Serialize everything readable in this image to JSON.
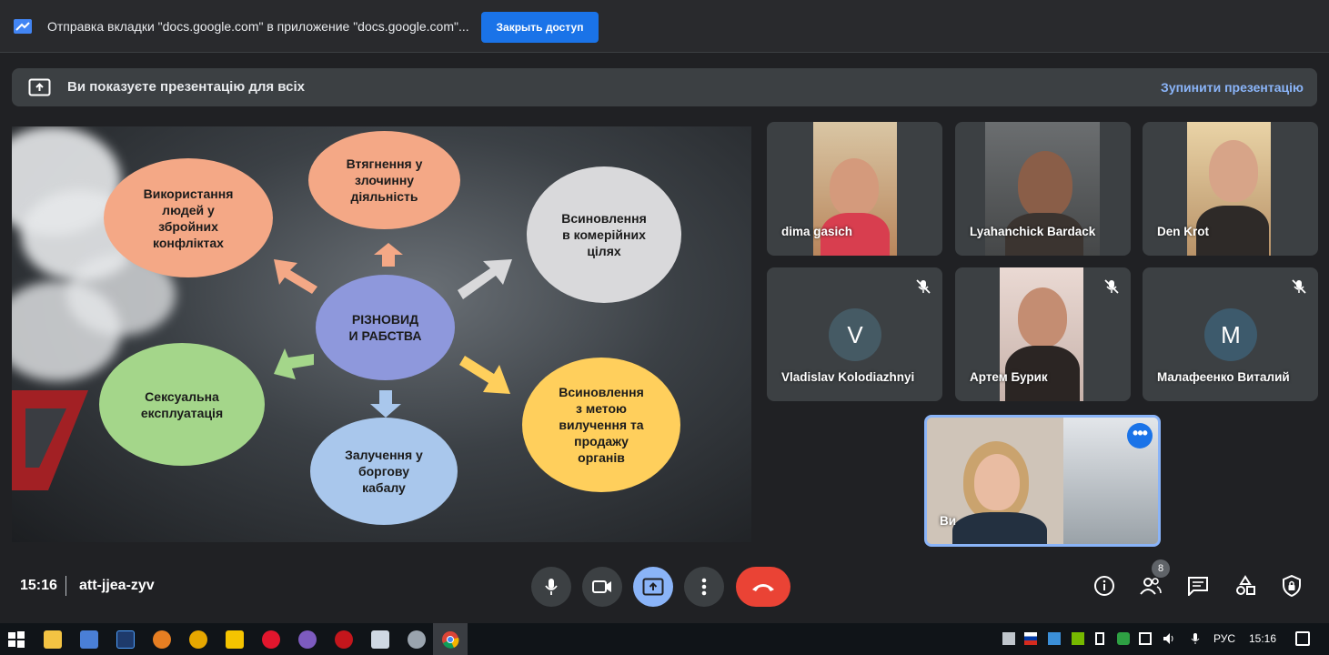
{
  "share_bar": {
    "text": "Отправка вкладки \"docs.google.com\" в приложение \"docs.google.com\"...",
    "stop_button": "Закрыть доступ"
  },
  "present_banner": {
    "text": "Ви показуєте презентацію для всіх",
    "stop_link": "Зупинити презентацію"
  },
  "slide": {
    "center": "РІЗНОВИД\nИ РАБСТВА",
    "bubbles": [
      "Використання\nлюдей у\nзбройних\nконфліктах",
      "Втягнення у\nзлочинну\nдіяльність",
      "Всиновлення\nв комерійних\nцілях",
      "Сексуальна\nексплуатація",
      "Залучення у\nборгову\nкабалу",
      "Всиновлення\nз метою\nвилучення та\nпродажу\nорганів"
    ]
  },
  "participants": [
    {
      "name": "dima gasich",
      "muted": false
    },
    {
      "name": "Lyahanchick Bardack",
      "muted": false
    },
    {
      "name": "Den Krot",
      "muted": false
    },
    {
      "name": "Vladislav Kolodiazhnyi",
      "initial": "V",
      "muted": true
    },
    {
      "name": "Артем Бурик",
      "muted": true
    },
    {
      "name": "Малафеенко Виталий",
      "initial": "M",
      "muted": true
    }
  ],
  "self_tile": {
    "name": "Ви"
  },
  "controls": {
    "time": "15:16",
    "meeting_code": "att-jjea-zyv",
    "participant_count": "8"
  },
  "taskbar": {
    "lang": "РУС",
    "clock": "15:16"
  },
  "colors": {
    "accent": "#1a73e8",
    "link": "#8ab4f8",
    "end_call": "#ea4335",
    "avatar_v": "#455a64",
    "avatar_m": "#3d5a6c"
  }
}
